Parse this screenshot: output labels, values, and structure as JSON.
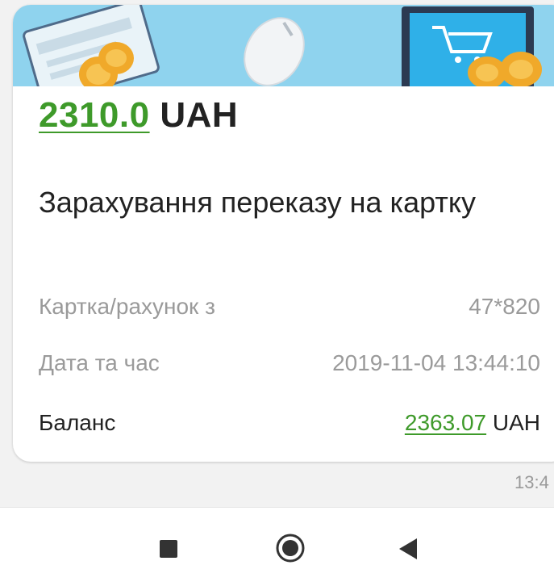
{
  "transaction": {
    "amount": "2310.0",
    "currency": "UAH",
    "title": "Зарахування переказу на картку",
    "details": [
      {
        "label": "Картка/рахунок з",
        "value": "47*820"
      },
      {
        "label": "Дата та час",
        "value": "2019-11-04 13:44:10"
      }
    ],
    "balance": {
      "label": "Баланс",
      "amount": "2363.07",
      "currency": "UAH"
    }
  },
  "message": {
    "time": "13:4"
  },
  "colors": {
    "accent_green": "#3e9a2a",
    "banner_blue": "#8fd3ee",
    "muted_text": "#9a9a9a"
  },
  "navbar": {
    "icons": [
      "recents-square-icon",
      "home-circle-icon",
      "back-triangle-icon"
    ]
  }
}
